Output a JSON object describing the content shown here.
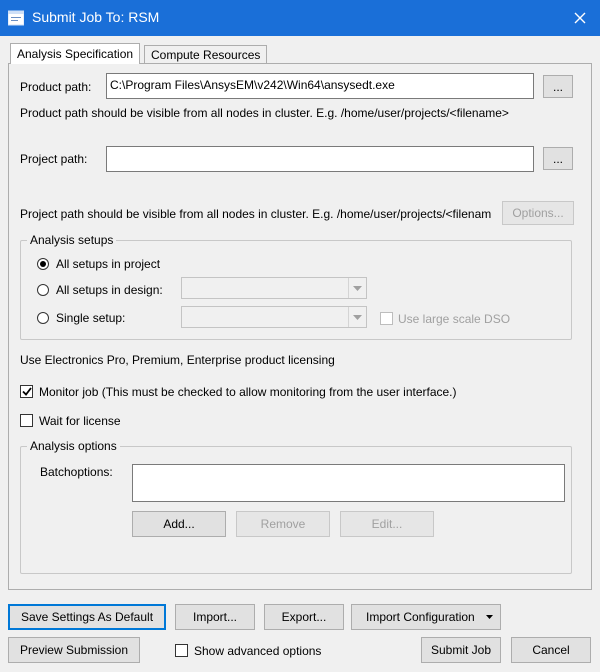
{
  "window": {
    "title": "Submit Job To: RSM"
  },
  "tabs": [
    {
      "label": "Analysis Specification",
      "active": true
    },
    {
      "label": "Compute Resources",
      "active": false
    }
  ],
  "product_path": {
    "label": "Product path:",
    "value": "C:\\Program Files\\AnsysEM\\v242\\Win64\\ansysedt.exe",
    "browse_label": "...",
    "hint": "Product path should be visible from all nodes in cluster. E.g. /home/user/projects/<filename>"
  },
  "project_path": {
    "label": "Project path:",
    "value": "",
    "browse_label": "...",
    "hint": "Project path should be visible from all nodes in cluster. E.g. /home/user/projects/<filenam",
    "options_label": "Options..."
  },
  "analysis_setups": {
    "title": "Analysis setups",
    "all_in_project": "All setups in project",
    "all_in_design": "All setups in design:",
    "single_setup": "Single setup:",
    "large_scale_dso": "Use large scale DSO",
    "selected": "all_in_project"
  },
  "licensing_text": "Use Electronics Pro, Premium, Enterprise product licensing",
  "monitor_job": {
    "label": "Monitor job (This must be checked to allow monitoring from the user interface.)",
    "checked": true
  },
  "wait_for_license": {
    "label": "Wait for license",
    "checked": false
  },
  "analysis_options": {
    "title": "Analysis options",
    "batchoptions_label": "Batchoptions:",
    "add_label": "Add...",
    "remove_label": "Remove",
    "edit_label": "Edit..."
  },
  "footer": {
    "save_settings": "Save Settings As Default",
    "import": "Import...",
    "export": "Export...",
    "import_configuration": "Import Configuration",
    "preview_submission": "Preview Submission",
    "show_advanced": "Show advanced options",
    "submit_job": "Submit Job",
    "cancel": "Cancel"
  },
  "colors": {
    "titlebar": "#1a6fd8",
    "dialog_bg": "#f0f0f0",
    "focus_border": "#0078d7"
  }
}
